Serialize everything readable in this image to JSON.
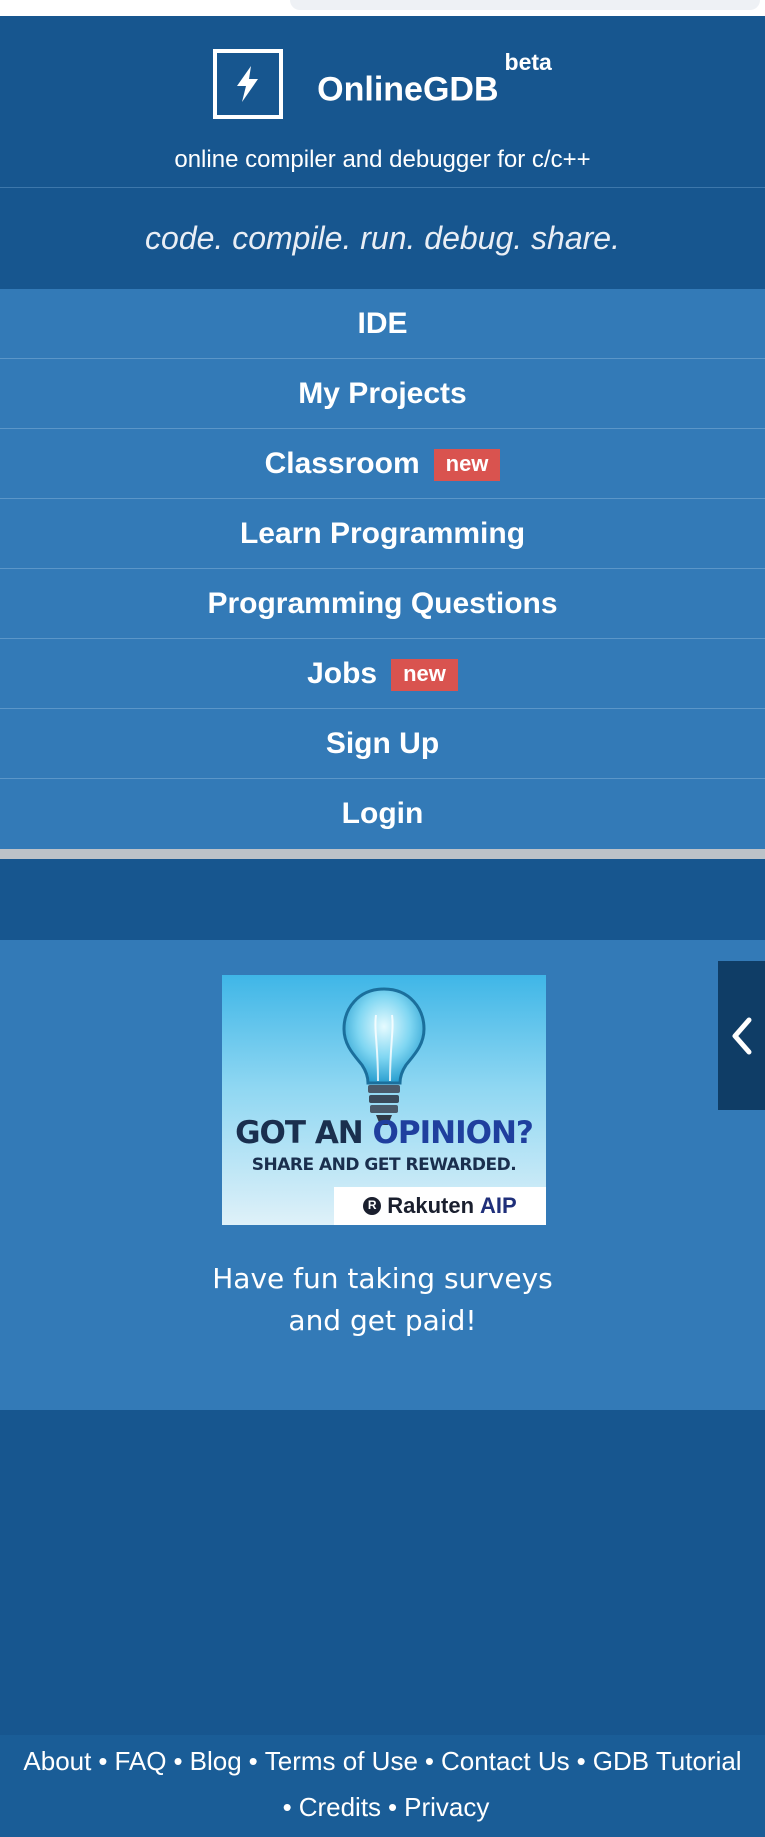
{
  "header": {
    "brand": "OnlineGDB",
    "brand_badge": "beta",
    "subtitle": "online compiler and debugger for c/c++",
    "logo_icon": "lightning-icon"
  },
  "tagline": "code. compile. run. debug. share.",
  "nav": {
    "items": [
      {
        "label": "IDE",
        "badge": ""
      },
      {
        "label": "My Projects",
        "badge": ""
      },
      {
        "label": "Classroom",
        "badge": "new"
      },
      {
        "label": "Learn Programming",
        "badge": ""
      },
      {
        "label": "Programming Questions",
        "badge": ""
      },
      {
        "label": "Jobs",
        "badge": "new"
      },
      {
        "label": "Sign Up",
        "badge": ""
      },
      {
        "label": "Login",
        "badge": ""
      }
    ]
  },
  "promo": {
    "ad": {
      "headline_part1": "GOT AN ",
      "headline_part2": "OPINION?",
      "subline": "SHARE AND GET REWARDED.",
      "brand_name": "Rakuten",
      "brand_suffix": "AIP"
    },
    "text_line1": "Have fun taking surveys",
    "text_line2": "and get paid!"
  },
  "side_tab": {
    "icon": "chevron-left-icon"
  },
  "footer": {
    "links": [
      "About",
      "FAQ",
      "Blog",
      "Terms of Use",
      "Contact Us",
      "GDB Tutorial",
      "Credits",
      "Privacy"
    ],
    "separator": "•"
  },
  "colors": {
    "header_bg": "#17568f",
    "nav_bg": "#337ab7",
    "badge_bg": "#d9534f",
    "side_tab_bg": "#0f3d66"
  }
}
